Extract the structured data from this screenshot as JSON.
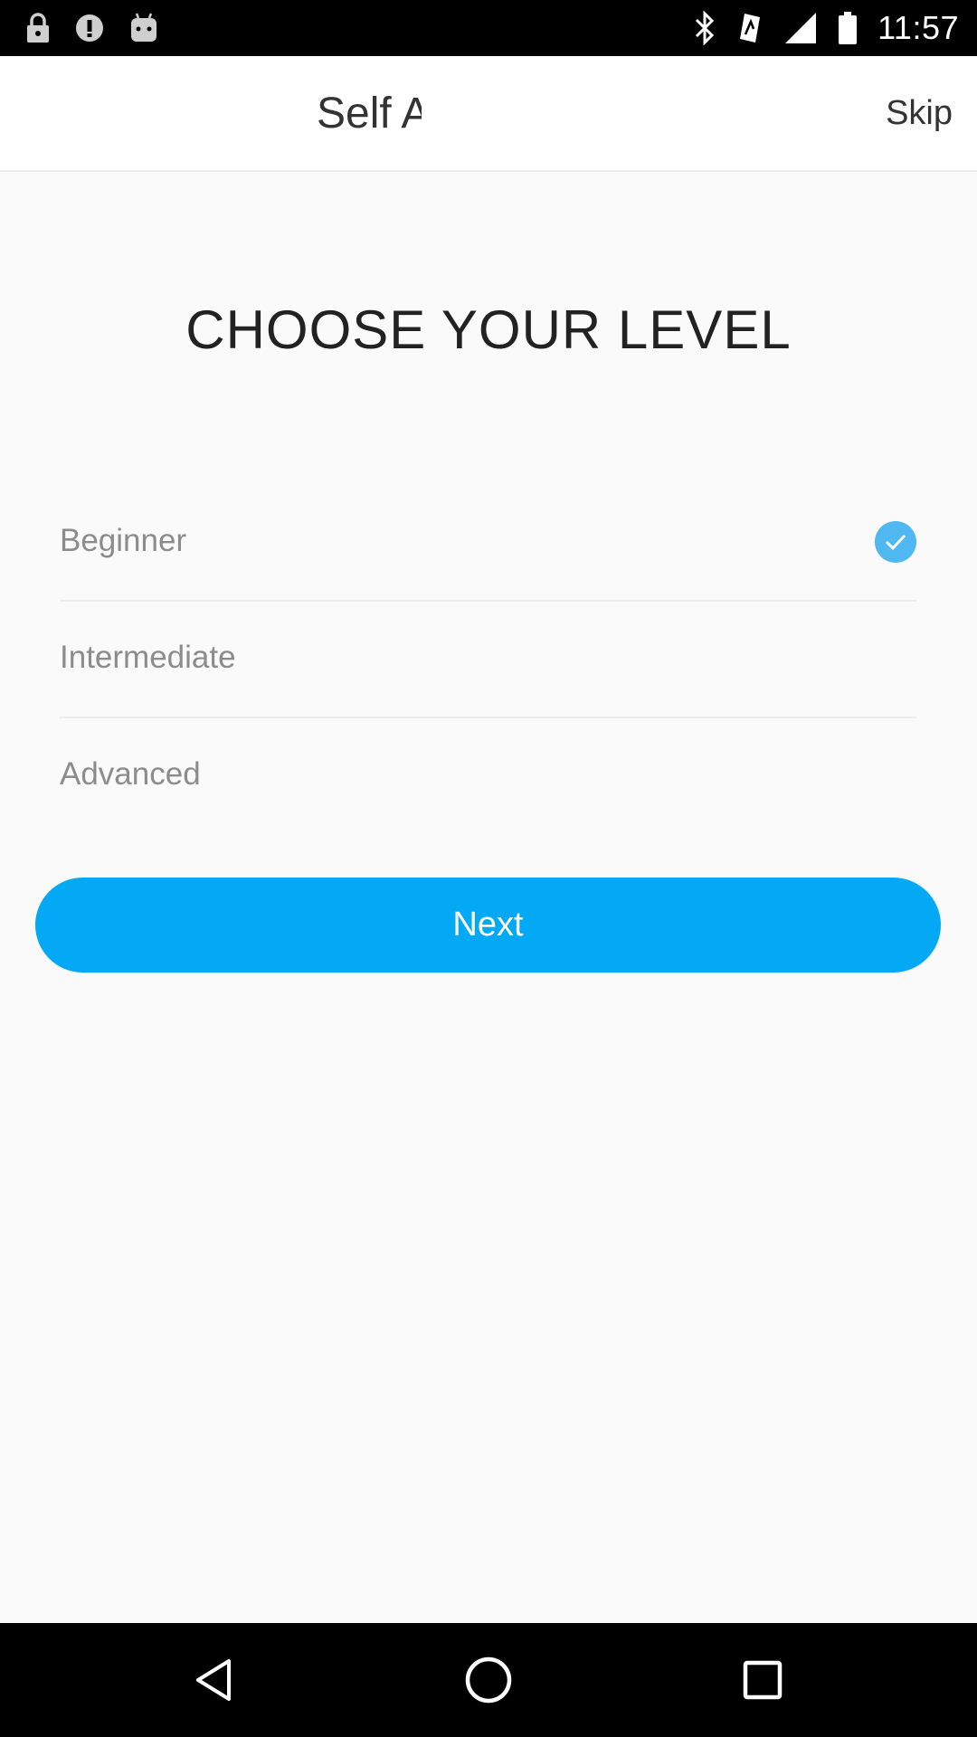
{
  "status_bar": {
    "time": "11:57",
    "left_icons": [
      "lock-icon",
      "info-icon",
      "android-icon"
    ],
    "right_icons": [
      "bluetooth-icon",
      "vibrate-icon",
      "signal-icon",
      "battery-icon"
    ]
  },
  "header": {
    "title": "Self A",
    "skip_label": "Skip"
  },
  "main": {
    "heading": "CHOOSE YOUR LEVEL",
    "levels": [
      {
        "label": "Beginner",
        "selected": true
      },
      {
        "label": "Intermediate",
        "selected": false
      },
      {
        "label": "Advanced",
        "selected": false
      }
    ],
    "next_label": "Next"
  },
  "nav_bar": {
    "icons": [
      "back-icon",
      "home-icon",
      "recents-icon"
    ]
  },
  "colors": {
    "accent": "#03a9f4",
    "check": "#4fb8f0",
    "background": "#fafafa"
  }
}
